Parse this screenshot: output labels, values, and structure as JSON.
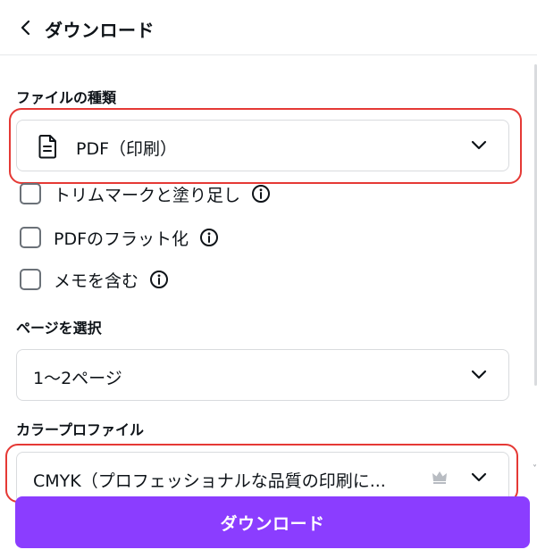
{
  "header": {
    "title": "ダウンロード"
  },
  "file_type": {
    "label": "ファイルの種類",
    "selected": "PDF（印刷）"
  },
  "options": [
    {
      "label": "トリムマークと塗り足し",
      "checked": false
    },
    {
      "label": "PDFのフラット化",
      "checked": false
    },
    {
      "label": "メモを含む",
      "checked": false
    }
  ],
  "pages": {
    "label": "ページを選択",
    "selected": "1〜2ページ"
  },
  "color_profile": {
    "label": "カラープロファイル",
    "selected": "CMYK（プロフェッショナルな品質の印刷に..."
  },
  "download_button": {
    "label": "ダウンロード"
  },
  "colors": {
    "accent": "#8b3dff",
    "highlight": "#e53935",
    "text": "#0e1318",
    "border": "#d9dbde"
  }
}
